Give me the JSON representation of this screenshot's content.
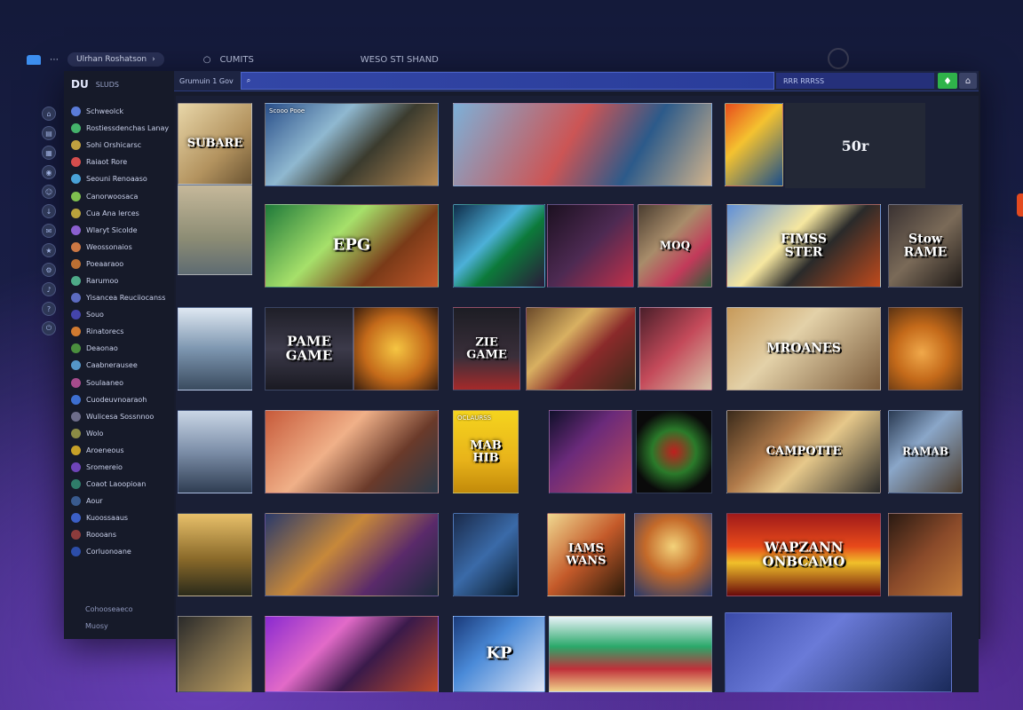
{
  "topbar": {
    "account_label": "Ulrhan Roshatson",
    "tab_label": "CUMITS",
    "window_title": "WESO STI SHAND"
  },
  "sidebar": {
    "brand": "DU",
    "brand_sub": "SLUDS",
    "items": [
      {
        "label": "Schweolck",
        "color": "#5a7bd8"
      },
      {
        "label": "Rostiessdenchas Lanay",
        "color": "#44b26b"
      },
      {
        "label": "Sohi Orshicarsc",
        "color": "#c0a040"
      },
      {
        "label": "Raiaot Rore",
        "color": "#d44d4d"
      },
      {
        "label": "Seouni Renoaaso",
        "color": "#49a2d8"
      },
      {
        "label": "Canorwoosaca",
        "color": "#7ec04f"
      },
      {
        "label": "Cua Ana lerces",
        "color": "#b9a23c"
      },
      {
        "label": "Wlaryt Sicolde",
        "color": "#8b5fd0"
      },
      {
        "label": "Weossonaios",
        "color": "#c74"
      },
      {
        "label": "Poeaaraoo",
        "color": "#bb6f33"
      },
      {
        "label": "Rarumoo",
        "color": "#4eaa88"
      },
      {
        "label": "Yisancea Reuciiocanss",
        "color": "#5c6bc0"
      },
      {
        "label": "Souo",
        "color": "#44a"
      },
      {
        "label": "Rinatorecs",
        "color": "#d07a30"
      },
      {
        "label": "Deaonao",
        "color": "#4b8f3e"
      },
      {
        "label": "Caabnerausee",
        "color": "#5596c8"
      },
      {
        "label": "Soulaaneo",
        "color": "#a64b8c"
      },
      {
        "label": "Cuodeuvnoaraoh",
        "color": "#3d6fd1"
      },
      {
        "label": "Wulicesa Sossnnoo",
        "color": "#6d6d8a"
      },
      {
        "label": "Wolo",
        "color": "#8b8b45"
      },
      {
        "label": "Aroeneous",
        "color": "#c6a028"
      },
      {
        "label": "Sromereio",
        "color": "#6e44b8"
      },
      {
        "label": "Coaot Laoopioan",
        "color": "#2f7c6a"
      },
      {
        "label": "Aour",
        "color": "#395a8e"
      },
      {
        "label": "Kuoossaaus",
        "color": "#3b5fc7"
      },
      {
        "label": "Roooans",
        "color": "#8c3c3c"
      },
      {
        "label": "Corluonoane",
        "color": "#2c4da8"
      }
    ],
    "footer": "Cohooseaeco",
    "footer2": "Muosy"
  },
  "toolbar": {
    "label": "Grumuin  1 Gov",
    "search_placeholder": "",
    "filter_label": "RRR RRRSS",
    "green_icon": "♦",
    "grey_icon": "⌂"
  },
  "counter": "50r",
  "tiles": [
    {
      "caption": "",
      "title": "SUBARE",
      "bg": "linear-gradient(135deg,#e8d6a8,#b3935f 60%,#6b5432)",
      "size": 13
    },
    {
      "caption": "Scooo Pooe",
      "title": "",
      "bg": "linear-gradient(135deg,#2a4f8a,#8fb8d0 35%,#3b3b2e 60%,#b88a53)",
      "size": 12
    },
    {
      "caption": "",
      "title": "",
      "bg": "linear-gradient(120deg,#7db0d8,#c55 45%,#2c5a8a 70%,#d2b48c)",
      "size": 12
    },
    {
      "caption": "",
      "title": "",
      "bg": "linear-gradient(135deg,#e74c1c,#f4c230 40%,#1a4d8a)",
      "size": 12
    },
    {
      "caption": "",
      "title": "",
      "bg": "linear-gradient(180deg,#c5b89a,#8c8c74 60%,#5e6b72)",
      "size": 12
    },
    {
      "caption": "",
      "title": "EPG",
      "bg": "linear-gradient(135deg,#1f7a3a,#a6e06a 40%,#7a3a18 70%,#c4582a)",
      "size": 18
    },
    {
      "caption": "",
      "title": "",
      "bg": "linear-gradient(135deg,#0f2d4a,#4cb0d8 40%,#0c7a3a 60%,#2a1a3a)",
      "size": 12
    },
    {
      "caption": "",
      "title": "",
      "bg": "linear-gradient(135deg,#1c1020,#4d2a52 50%,#c1304a)",
      "size": 12
    },
    {
      "caption": "",
      "title": "MOQ",
      "bg": "linear-gradient(135deg,#4a3d30,#a88c6a 40%,#c23a5a 70%,#2c5e3a)",
      "size": 12
    },
    {
      "caption": "",
      "title": "FIMSS\nSTER",
      "bg": "linear-gradient(135deg,#5f8fd8,#f6e7a0 40%,#2a2a2a 60%,#c04a1c)",
      "size": 14
    },
    {
      "caption": "",
      "title": "Stow\nRAME",
      "bg": "linear-gradient(135deg,#3a3232,#7a6a58 50%,#1f1a18)",
      "size": 14
    },
    {
      "caption": "",
      "title": "",
      "bg": "linear-gradient(180deg,#dfe8f2,#7d96b0 50%,#3a4b5f)",
      "size": 12
    },
    {
      "caption": "",
      "title": "PAME\nGAME",
      "bg": "linear-gradient(180deg,#1f1f28,#3c3a4a 50%,#1a1a22)",
      "size": 15
    },
    {
      "caption": "",
      "title": "",
      "bg": "radial-gradient(circle at 50% 50%,#f5c542,#c46a1a 55%,#3a1f0f)",
      "size": 12
    },
    {
      "caption": "",
      "title": "ZIE\nGAME",
      "bg": "linear-gradient(180deg,#1d1d24,#3a2f3a 60%,#a52a2a)",
      "size": 13
    },
    {
      "caption": "",
      "title": "",
      "bg": "linear-gradient(135deg,#6b4a2a,#d8b061 35%,#8a2a2a 60%,#3a2a1a)",
      "size": 12
    },
    {
      "caption": "",
      "title": "",
      "bg": "linear-gradient(135deg,#4b1f2a,#c44a5a 50%,#d6c2a8)",
      "size": 12
    },
    {
      "caption": "",
      "title": "MROANES",
      "bg": "linear-gradient(135deg,#c79a5a,#e3d1a8 40%,#7a5a3a)",
      "size": 14
    },
    {
      "caption": "",
      "title": "",
      "bg": "radial-gradient(circle at 45% 55%,#f0a84a,#c46a1a 45%,#4a2a12)",
      "size": 12
    },
    {
      "caption": "",
      "title": "",
      "bg": "linear-gradient(180deg,#c9d6e6,#7c8ea8 50%,#2f3d52)",
      "size": 12
    },
    {
      "caption": "",
      "title": "",
      "bg": "linear-gradient(135deg,#c75a3a,#f0b088 40%,#6a3a2a 70%,#2a3a4a)",
      "size": 12
    },
    {
      "caption": "OCLAURSS",
      "title": "MAB\nHIB",
      "bg": "linear-gradient(180deg,#f5d41e,#e8b31a 60%,#c28a0a)",
      "size": 13
    },
    {
      "caption": "",
      "title": "",
      "bg": "linear-gradient(135deg,#10102a,#6a2a7a 40%,#c04a5a)",
      "size": 12
    },
    {
      "caption": "",
      "title": "",
      "bg": "radial-gradient(circle at 50% 50%,#c01f1f,#2a7a2a 40%,#0a0a0a 75%)",
      "size": 12
    },
    {
      "caption": "",
      "title": "CAMPOTTE",
      "bg": "linear-gradient(135deg,#3a2a1a,#b07a4a 35%,#e6c88a 55%,#2a2a2a)",
      "size": 13
    },
    {
      "caption": "",
      "title": "RAMAB",
      "bg": "linear-gradient(135deg,#2a3a52,#8aa6c8 40%,#4a3a2a)",
      "size": 12
    },
    {
      "caption": "",
      "title": "",
      "bg": "linear-gradient(180deg,#e8c06a,#8a6a2a 55%,#2a2a1a)",
      "size": 12
    },
    {
      "caption": "",
      "title": "",
      "bg": "linear-gradient(135deg,#2a3a6a,#c7883a 40%,#5a2a6a 70%,#1a2a3a)",
      "size": 12
    },
    {
      "caption": "",
      "title": "",
      "bg": "linear-gradient(135deg,#1a2a4a,#3a6aa8 50%,#0a1a2a)",
      "size": 12
    },
    {
      "caption": "",
      "title": "IAMS\nWANS",
      "bg": "linear-gradient(135deg,#f0d890,#c45a2a 50%,#2a1a0a)",
      "size": 13
    },
    {
      "caption": "",
      "title": "",
      "bg": "radial-gradient(circle at 50% 40%,#f3d27a,#c46a2a 45%,#2a3a6a)",
      "size": 12
    },
    {
      "caption": "",
      "title": "WAPZANN\nONBCAMO",
      "bg": "linear-gradient(180deg,#a01a1a,#e84a1a 40%,#f0c02a 60%,#6a0a0a)",
      "size": 15
    },
    {
      "caption": "",
      "title": "",
      "bg": "linear-gradient(135deg,#2a1a12,#8a4a2a 50%,#c07a3a)",
      "size": 12
    },
    {
      "caption": "",
      "title": "",
      "bg": "linear-gradient(135deg,#2a2a2a,#7a6a4a 50%,#c0a060)",
      "size": 12
    },
    {
      "caption": "",
      "title": "",
      "bg": "linear-gradient(135deg,#8a2ad0,#e26ac8 35%,#3a1a4a 60%,#c04a2a)",
      "size": 12
    },
    {
      "caption": "",
      "title": "KP",
      "bg": "linear-gradient(135deg,#1a3a7a,#4a8ad8 40%,#e0e6f6)",
      "size": 18
    },
    {
      "caption": "",
      "title": "",
      "bg": "linear-gradient(180deg,#e8f2f8,#2aa86a 40%,#c0303a 70%,#f0d28a)",
      "size": 12
    },
    {
      "caption": "",
      "title": "",
      "bg": "linear-gradient(135deg,#3a4aa8,#6a7ad8 40%,#1a2a5a)",
      "size": 12
    }
  ]
}
